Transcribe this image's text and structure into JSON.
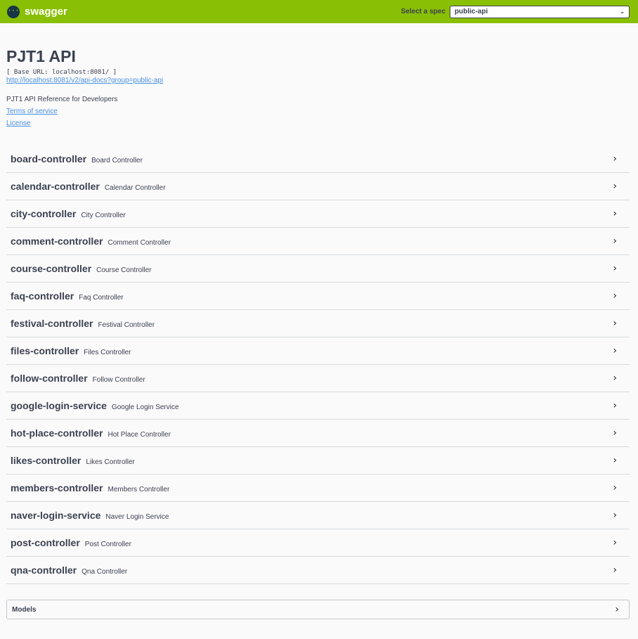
{
  "topbar": {
    "brand": "swagger",
    "logo_glyph": "{···}",
    "spec_label": "Select a spec",
    "spec_value": "public-api"
  },
  "info": {
    "title": "PJT1 API",
    "base_url": "[ Base URL: localhost:8081/ ]",
    "spec_link": "http://localhost:8081/v2/api-docs?group=public-api",
    "description": "PJT1 API Reference for Developers",
    "terms": "Terms of service",
    "license": "License"
  },
  "tags": [
    {
      "name": "board-controller",
      "desc": "Board Controller"
    },
    {
      "name": "calendar-controller",
      "desc": "Calendar Controller"
    },
    {
      "name": "city-controller",
      "desc": "City Controller"
    },
    {
      "name": "comment-controller",
      "desc": "Comment Controller"
    },
    {
      "name": "course-controller",
      "desc": "Course Controller"
    },
    {
      "name": "faq-controller",
      "desc": "Faq Controller"
    },
    {
      "name": "festival-controller",
      "desc": "Festival Controller"
    },
    {
      "name": "files-controller",
      "desc": "Files Controller"
    },
    {
      "name": "follow-controller",
      "desc": "Follow Controller"
    },
    {
      "name": "google-login-service",
      "desc": "Google Login Service"
    },
    {
      "name": "hot-place-controller",
      "desc": "Hot Place Controller"
    },
    {
      "name": "likes-controller",
      "desc": "Likes Controller"
    },
    {
      "name": "members-controller",
      "desc": "Members Controller"
    },
    {
      "name": "naver-login-service",
      "desc": "Naver Login Service"
    },
    {
      "name": "post-controller",
      "desc": "Post Controller"
    },
    {
      "name": "qna-controller",
      "desc": "Qna Controller"
    }
  ],
  "models": {
    "title": "Models"
  },
  "icons": {
    "expand": "chevron-right-icon",
    "dropdown": "chevron-down-icon"
  },
  "colors": {
    "topbar": "#89bf04",
    "link": "#4990e2",
    "text": "#3b4151"
  }
}
